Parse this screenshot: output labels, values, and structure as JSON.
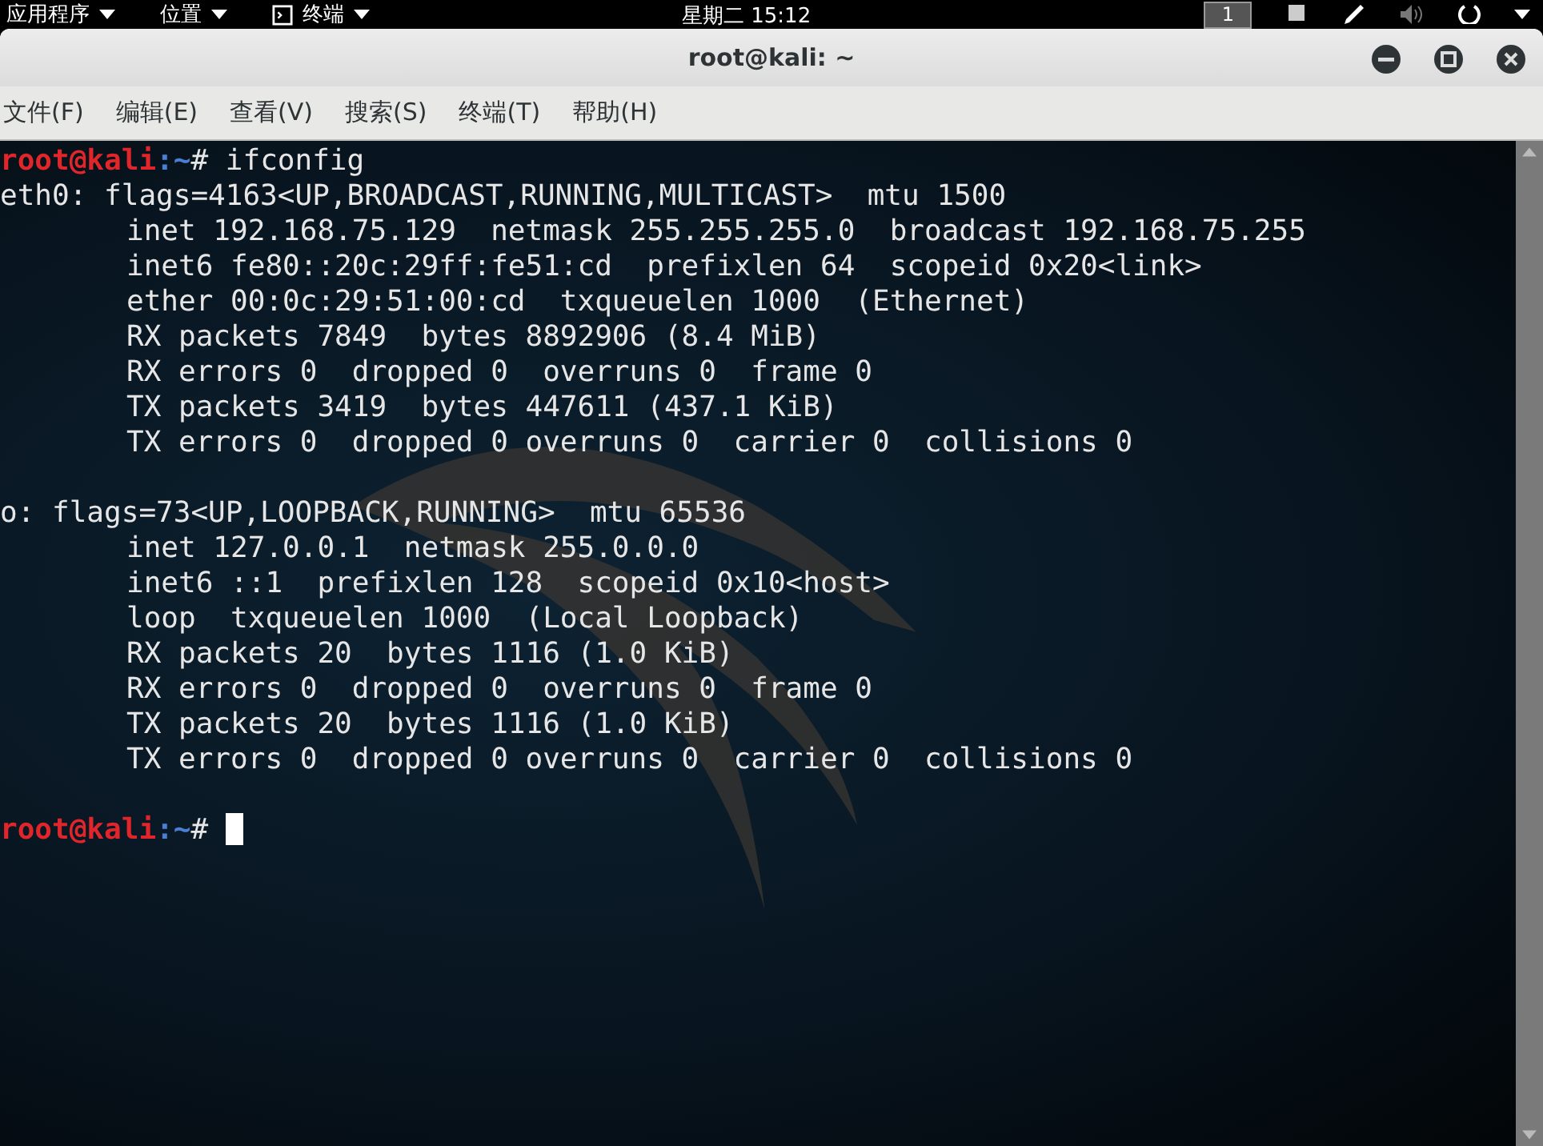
{
  "top_bar": {
    "menus": [
      {
        "label": "应用程序",
        "kind": "menu"
      },
      {
        "label": "位置",
        "kind": "menu"
      },
      {
        "label": "终端",
        "kind": "app"
      }
    ],
    "clock": "星期二 15:12",
    "workspace": "1"
  },
  "window": {
    "title": "root@kali: ~"
  },
  "menu_bar": [
    "文件(F)",
    "编辑(E)",
    "查看(V)",
    "搜索(S)",
    "终端(T)",
    "帮助(H)"
  ],
  "terminal": {
    "lines": [
      {
        "kind": "prompt",
        "user": "root@kali",
        "path": ":~",
        "symbol": "#",
        "command": "ifconfig",
        "cursor": false
      },
      {
        "kind": "header",
        "text": "eth0: flags=4163<UP,BROADCAST,RUNNING,MULTICAST>  mtu 1500"
      },
      {
        "kind": "detail",
        "text": "inet 192.168.75.129  netmask 255.255.255.0  broadcast 192.168.75.255"
      },
      {
        "kind": "detail",
        "text": "inet6 fe80::20c:29ff:fe51:cd  prefixlen 64  scopeid 0x20<link>"
      },
      {
        "kind": "detail",
        "text": "ether 00:0c:29:51:00:cd  txqueuelen 1000  (Ethernet)"
      },
      {
        "kind": "detail",
        "text": "RX packets 7849  bytes 8892906 (8.4 MiB)"
      },
      {
        "kind": "detail",
        "text": "RX errors 0  dropped 0  overruns 0  frame 0"
      },
      {
        "kind": "detail",
        "text": "TX packets 3419  bytes 447611 (437.1 KiB)"
      },
      {
        "kind": "detail",
        "text": "TX errors 0  dropped 0 overruns 0  carrier 0  collisions 0"
      },
      {
        "kind": "blank"
      },
      {
        "kind": "header",
        "text": "o: flags=73<UP,LOOPBACK,RUNNING>  mtu 65536"
      },
      {
        "kind": "detail",
        "text": "inet 127.0.0.1  netmask 255.0.0.0"
      },
      {
        "kind": "detail",
        "text": "inet6 ::1  prefixlen 128  scopeid 0x10<host>"
      },
      {
        "kind": "detail",
        "text": "loop  txqueuelen 1000  (Local Loopback)"
      },
      {
        "kind": "detail",
        "text": "RX packets 20  bytes 1116 (1.0 KiB)"
      },
      {
        "kind": "detail",
        "text": "RX errors 0  dropped 0  overruns 0  frame 0"
      },
      {
        "kind": "detail",
        "text": "TX packets 20  bytes 1116 (1.0 KiB)"
      },
      {
        "kind": "detail",
        "text": "TX errors 0  dropped 0 overruns 0  carrier 0  collisions 0"
      },
      {
        "kind": "blank"
      },
      {
        "kind": "prompt",
        "user": "root@kali",
        "path": ":~",
        "symbol": "#",
        "cursor": true
      }
    ]
  }
}
